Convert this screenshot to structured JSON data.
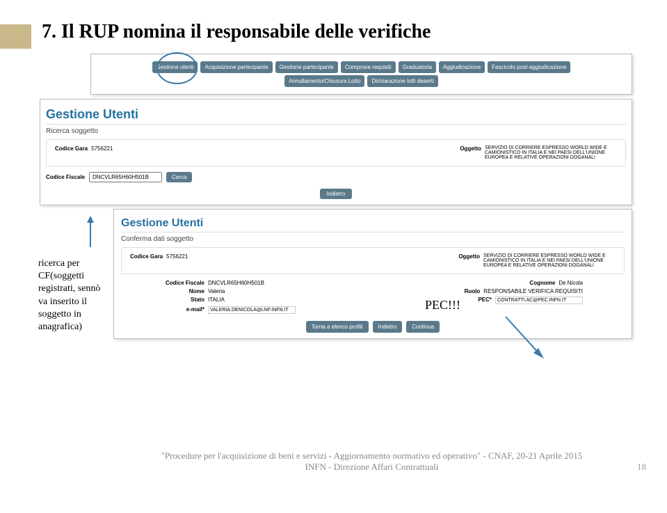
{
  "slide": {
    "title": "7. Il RUP nomina il responsabile delle verifiche"
  },
  "buttonBar": {
    "row1": [
      "Gestione utenti",
      "Acquisizione partecipante",
      "Gestione partecipante",
      "Comprova requisiti",
      "Graduatoria",
      "Aggiudicazione",
      "Fascicolo post-aggiudicazione"
    ],
    "row2": [
      "Annullamento/Chiusura Lotto",
      "Dichiarazione lotti deserti"
    ]
  },
  "panel1": {
    "title": "Gestione Utenti",
    "subtitle": "Ricerca soggetto",
    "codiceGaraLabel": "Codice Gara",
    "codiceGaraValue": "5756221",
    "oggettoLabel": "Oggetto",
    "oggettoValue": "SERVIZIO DI CORRIERE ESPRESSO WORLD WIDE E CAMIONISTICO IN ITALIA E NEI PAESI DELL'UNIONE EUROPEA E RELATIVE OPERAZIONI DOGANALI",
    "cfLabel": "Codice Fiscale",
    "cfValue": "DNCVLR65H60H501B",
    "cercaLabel": "Cerca",
    "indietroLabel": "Indietro"
  },
  "sideNote": "ricerca per CF(soggetti registrati, sennò va inserito il soggetto in anagrafica)",
  "panel2": {
    "title": "Gestione Utenti",
    "subtitle": "Conferma dati soggetto",
    "codiceGaraLabel": "Codice Gara",
    "codiceGaraValue": "5756221",
    "oggettoLabel": "Oggetto",
    "oggettoValue": "SERVIZIO DI CORRIERE ESPRESSO WORLD WIDE E CAMIONISTICO IN ITALIA E NEI PAESI DELL'UNIONE EUROPEA E RELATIVE OPERAZIONI DOGANALI",
    "cfLabel": "Codice Fiscale",
    "cfValue": "DNCVLR65H60H501B",
    "nomeLabel": "Nome",
    "nomeValue": "Valeria",
    "cognomeLabel": "Cognome",
    "cognomeValue": "De Nicola",
    "statoLabel": "Stato",
    "statoValue": "ITALIA",
    "ruoloLabel": "Ruolo",
    "ruoloValue": "RESPONSABILE VERIFICA REQUISITI",
    "emailLabel": "e-mail*",
    "emailValue": "VALERIA.DENICOLA@LNF.INFN.IT",
    "pecLabel": "PEC*",
    "pecValue": "CONTRATTI.AC@PEC.INFN.IT",
    "btn1": "Torna a elenco profili",
    "btn2": "Indietro",
    "btn3": "Continua"
  },
  "pecAnnotation": "PEC!!!",
  "footer": {
    "line1": "\"Procedure per l'acquisizione di beni e servizi - Aggiornamento normativo ed operativo\" - CNAF, 20-21 Aprile 2015",
    "line2": "INFN - Direzione Affari Contrattuali",
    "page": "18"
  }
}
